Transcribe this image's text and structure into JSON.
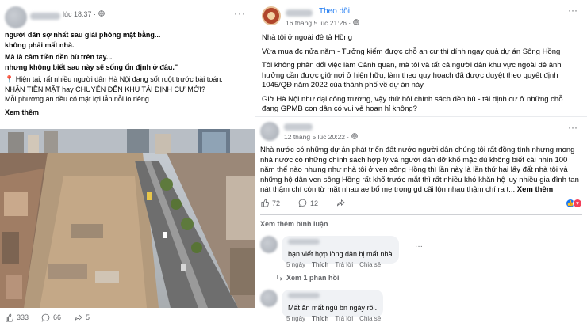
{
  "left_post": {
    "time": "lúc 18:37 ·",
    "more_icon": "ellipsis-icon",
    "globe_icon": "globe-icon",
    "line1": "người dân sợ nhất sau giải phóng mặt bằng...",
    "line2": "không phải mất nhà.",
    "line3": "Mà là cầm tiền đền bù trên tay...",
    "line4": "nhưng không biết sau này sẽ sống ổn định ở đâu.\"",
    "line5": "Hiện tại, rất nhiều người dân Hà Nội đang sốt ruột trước bài toán:",
    "line6": "NHẬN TIỀN MẶT hay CHUYỂN ĐẾN KHU TÁI ĐỊNH CƯ MỚI?",
    "line7": "Mỗi phương án đều có mặt lợi lẫn nỗi lo riêng...",
    "see_more": "Xem thêm",
    "reactions": "333",
    "comments": "66",
    "shares": "5"
  },
  "right_top_post": {
    "follow": "Theo dõi",
    "time": "16 tháng 5 lúc 21:26 ·",
    "p1": "Nhà tôi ở ngoài đê tả Hồng",
    "p2": "Vừa mua đc nửa năm - Tưởng kiếm được chỗ an cư thì dính ngay quả dự án Sông Hồng",
    "p3": "Tôi không phản đối việc làm Cảnh quan, mà tôi và tất cả người dân khu vực ngoài đê ảnh hưởng cần được giữ nơi ở hiện hữu, làm theo quy hoạch đã được duyệt theo quyết định 1045/QĐ năm 2022 của thành phố về dự án này.",
    "p4": "Giờ Hà Nội như đại công trường, vậy thử hỏi chính sách đền bù - tái định cư ở những chỗ đang GPMB con dân có vui vẻ hoan hỉ không?"
  },
  "right_bottom_post": {
    "time": "12 tháng 5 lúc 20:22 ·",
    "body": "Nhà nước có những dự án phát triển đất nước người dân chúng tôi rất đồng tình nhưng mong nhà nước có những chính sách hợp lý và người dân dỡ khổ mặc dù không biết cái nhìn 100 năm thế nào nhưng như nhà tôi ở ven sông Hồng thì lần này là lần thứ hai lấy đất nhà tôi và những hộ dân ven sông Hồng rất khổ trước mắt thì rất nhiều khó khăn hệ luỵ nhiều gia đình tan nát thậm chí còn từ mặt nhau ae bố mẹ trong gd cãi lộn nhau thậm chí ra t...",
    "see_more": "Xem thêm",
    "likes": "72",
    "comments": "12",
    "see_more_comments": "Xem thêm bình luận",
    "comment1": {
      "text": "bạn viết hợp lòng dân bị mất nhà",
      "age": "5 ngày",
      "like": "Thích",
      "reply": "Trả lời",
      "share": "Chia sẻ",
      "replies": "Xem 1 phản hồi"
    },
    "comment2": {
      "text": "Mất ăn mất ngủ bn ngày rồi.",
      "age": "5 ngày",
      "like": "Thích",
      "reply": "Trả lời",
      "share": "Chia sẻ"
    }
  }
}
